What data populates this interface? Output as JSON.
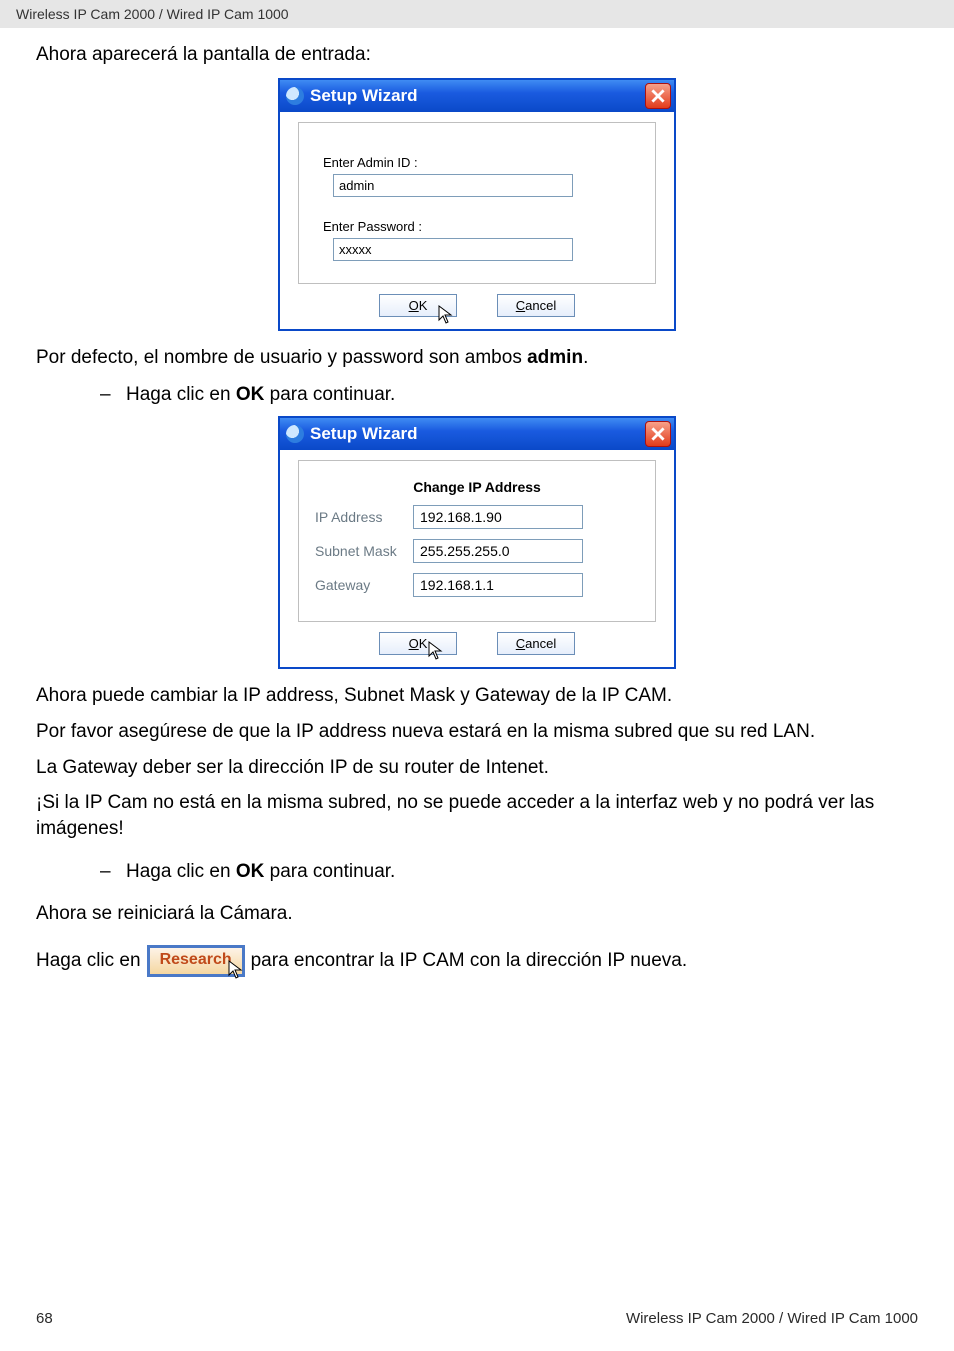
{
  "header": "Wireless IP Cam 2000 / Wired IP Cam 1000",
  "intro_line": "Ahora aparecerá la pantalla de entrada:",
  "dialog1": {
    "title": "Setup Wizard",
    "admin_label": "Enter Admin ID :",
    "admin_value": "admin",
    "password_label": "Enter Password :",
    "password_value": "xxxxx",
    "ok": "OK",
    "cancel": "Cancel"
  },
  "para_default_prefix": "Por defecto, el nombre de usuario y password son ambos ",
  "para_default_bold": "admin",
  "para_default_suffix": ".",
  "bullet1_dash": "–",
  "bullet1_prefix": "Haga clic en ",
  "bullet1_bold": "OK",
  "bullet1_suffix": " para continuar.",
  "dialog2": {
    "title": "Setup Wizard",
    "section": "Change IP Address",
    "ip_label": "IP Address",
    "ip_value": "192.168.1.90",
    "mask_label": "Subnet Mask",
    "mask_value": "255.255.255.0",
    "gw_label": "Gateway",
    "gw_value": "192.168.1.1",
    "ok": "OK",
    "cancel": "Cancel"
  },
  "para_change1": "Ahora puede cambiar la IP address, Subnet Mask y Gateway de la IP CAM.",
  "para_change2": "Por favor asegúrese de que la IP address nueva estará en la misma subred que su red LAN.",
  "para_change3": "La Gateway deber ser la dirección IP de su router de Intenet.",
  "para_change4": "¡Si la IP Cam no está en la misma subred, no se puede acceder a la interfaz web y no podrá ver las imágenes!",
  "bullet2_dash": "–",
  "bullet2_prefix": "Haga clic en ",
  "bullet2_bold": "OK",
  "bullet2_suffix": " para continuar.",
  "para_restart": "Ahora se reiniciará la Cámara.",
  "inline_prefix": "Haga clic en",
  "research_label": "Research",
  "inline_suffix": "para encontrar la IP CAM con la dirección IP nueva.",
  "footer_page": "68",
  "footer_right": "Wireless IP Cam 2000 / Wired IP Cam 1000"
}
